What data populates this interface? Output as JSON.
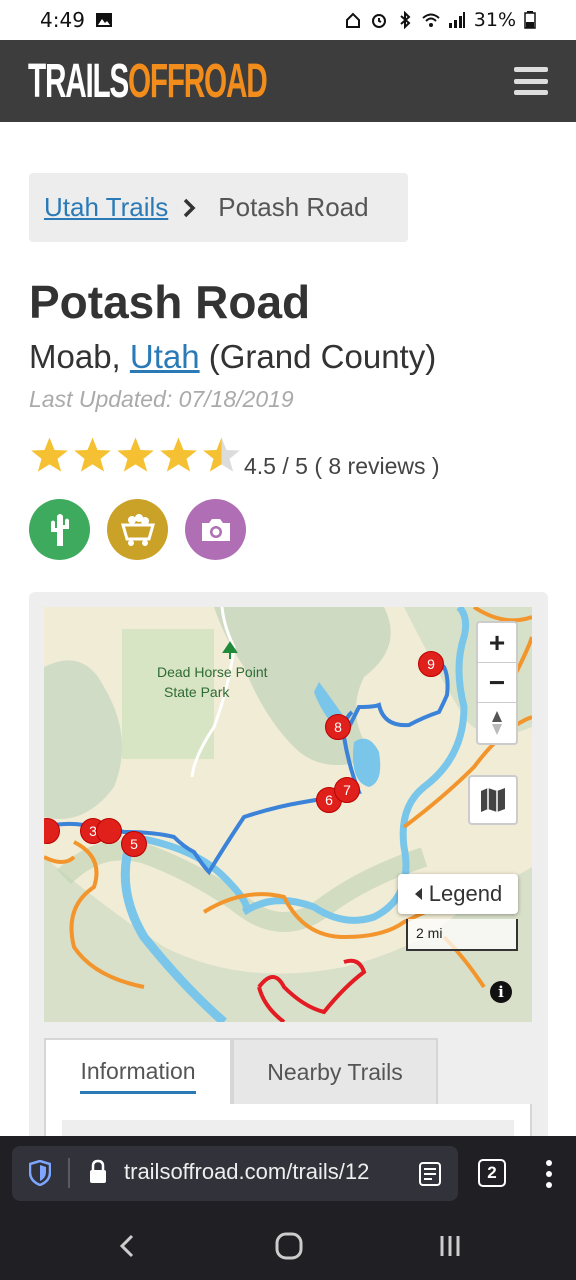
{
  "status": {
    "time": "4:49",
    "battery": "31%"
  },
  "header": {
    "logo_white": "TRAILS",
    "logo_orange": "OFFROAD"
  },
  "breadcrumb": {
    "link": "Utah Trails ",
    "current": "Potash Road"
  },
  "trail": {
    "title": "Potash Road",
    "location_prefix": "Moab, ",
    "state_link": "Utah",
    "county": " (Grand County)",
    "updated": "Last Updated: 07/18/2019",
    "rating_value": 4.5,
    "rating_text": "4.5 / 5 ( 8 reviews )"
  },
  "badges": [
    {
      "name": "cactus-icon",
      "color": "#3daa5e"
    },
    {
      "name": "mine-cart-icon",
      "color": "#c9a227"
    },
    {
      "name": "camera-icon",
      "color": "#b06fb5"
    }
  ],
  "map": {
    "park_label_1": "Dead Horse Point",
    "park_label_2": "State Park",
    "markers": [
      "3",
      "5",
      "6",
      "7",
      "8",
      "9"
    ],
    "zoom_in": "+",
    "zoom_out": "−",
    "legend": "Legend",
    "scale": "2 mi",
    "info": "i"
  },
  "tabs": {
    "information": "Information",
    "nearby": "Nearby Trails"
  },
  "browser": {
    "url": "trailsoffroad.com/trails/12",
    "tab_count": "2"
  }
}
